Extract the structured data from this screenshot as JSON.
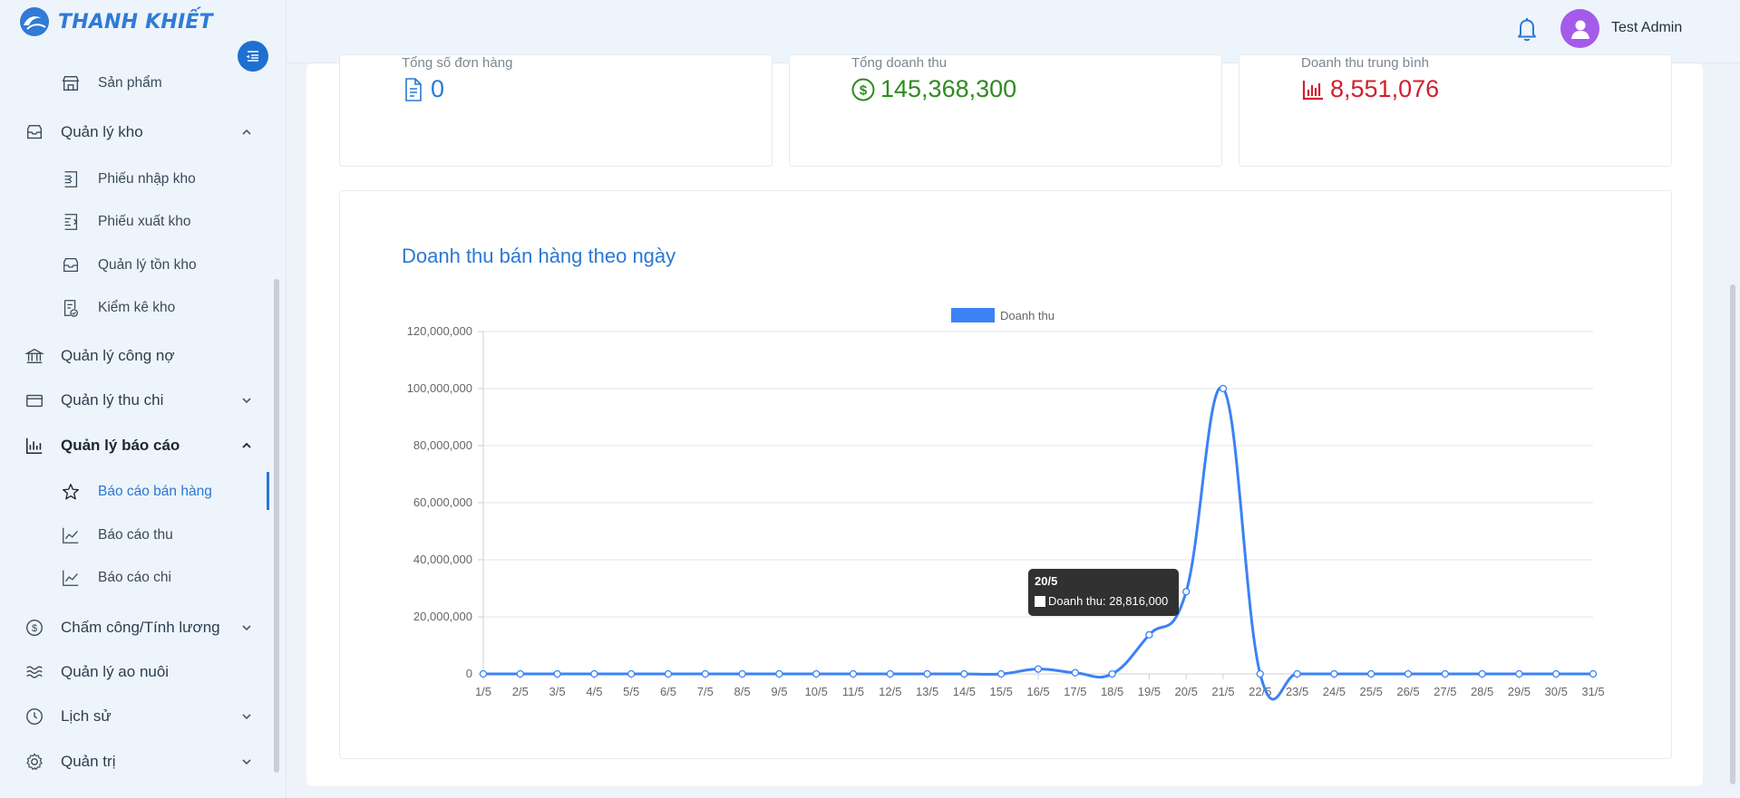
{
  "app": {
    "logo_text": "THANH KHIẾT"
  },
  "header": {
    "username": "Test Admin"
  },
  "sidebar": {
    "items": [
      {
        "label": "Sản phẩm"
      },
      {
        "label": "Quản lý kho"
      },
      {
        "label": "Phiếu nhập kho"
      },
      {
        "label": "Phiếu xuất kho"
      },
      {
        "label": "Quản lý tồn kho"
      },
      {
        "label": "Kiểm kê kho"
      },
      {
        "label": "Quản lý công nợ"
      },
      {
        "label": "Quản lý thu chi"
      },
      {
        "label": "Quản lý báo cáo"
      },
      {
        "label": "Báo cáo bán hàng"
      },
      {
        "label": "Báo cáo thu"
      },
      {
        "label": "Báo cáo chi"
      },
      {
        "label": "Chấm công/Tính lương"
      },
      {
        "label": "Quản lý ao nuôi"
      },
      {
        "label": "Lịch sử"
      },
      {
        "label": "Quản trị"
      }
    ]
  },
  "stats": [
    {
      "label": "Tổng số đơn hàng",
      "value": "0",
      "color": "#2a78d4"
    },
    {
      "label": "Tổng doanh thu",
      "value": "145,368,300",
      "color": "#2e8b1f"
    },
    {
      "label": "Doanh thu trung bình",
      "value": "8,551,076",
      "color": "#d0202e"
    }
  ],
  "chart_title": "Doanh thu bán hàng theo ngày",
  "tooltip": {
    "title": "20/5",
    "text": "Doanh thu: 28,816,000"
  },
  "chart_data": {
    "type": "line",
    "title": "",
    "legend": "top",
    "grid": true,
    "ylim": [
      0,
      120000000
    ],
    "y_ticks": [
      "0",
      "20,000,000",
      "40,000,000",
      "60,000,000",
      "80,000,000",
      "100,000,000",
      "120,000,000"
    ],
    "y_tick_values": [
      0,
      20000000,
      40000000,
      60000000,
      80000000,
      100000000,
      120000000
    ],
    "categories": [
      "1/5",
      "2/5",
      "3/5",
      "4/5",
      "5/5",
      "6/5",
      "7/5",
      "8/5",
      "9/5",
      "10/5",
      "11/5",
      "12/5",
      "13/5",
      "14/5",
      "15/5",
      "16/5",
      "17/5",
      "18/5",
      "19/5",
      "20/5",
      "21/5",
      "22/5",
      "23/5",
      "24/5",
      "25/5",
      "26/5",
      "27/5",
      "28/5",
      "29/5",
      "30/5",
      "31/5"
    ],
    "series": [
      {
        "name": "Doanh thu",
        "color": "#3b82f6",
        "values": [
          0,
          0,
          0,
          0,
          0,
          0,
          0,
          0,
          0,
          0,
          0,
          0,
          0,
          0,
          0,
          1700000,
          400000,
          0,
          13700000,
          28816000,
          100000000,
          0,
          0,
          0,
          0,
          0,
          0,
          0,
          0,
          0,
          0
        ]
      }
    ]
  }
}
